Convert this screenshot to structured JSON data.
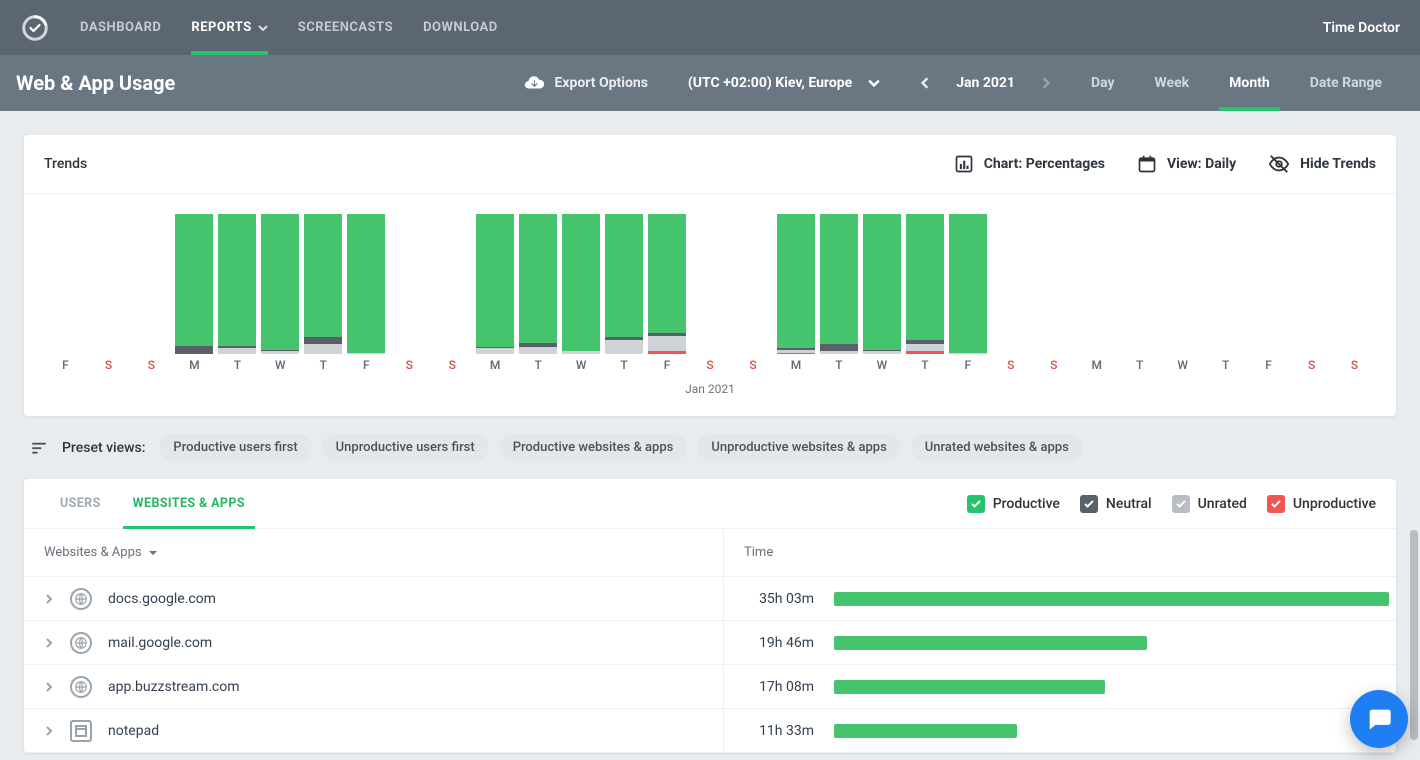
{
  "brand": "Time Doctor",
  "nav": {
    "dashboard": "DASHBOARD",
    "reports": "REPORTS",
    "screencasts": "SCREENCASTS",
    "download": "DOWNLOAD"
  },
  "page_title": "Web & App Usage",
  "subbar": {
    "export": "Export Options",
    "timezone": "(UTC +02:00) Kiev, Europe",
    "date_label": "Jan 2021",
    "periods": {
      "day": "Day",
      "week": "Week",
      "month": "Month",
      "range": "Date Range"
    },
    "selected_period": "month"
  },
  "trends": {
    "title": "Trends",
    "chart_label": "Chart: Percentages",
    "view_label": "View: Daily",
    "hide_label": "Hide Trends",
    "month_caption": "Jan 2021"
  },
  "presets": {
    "label": "Preset views:",
    "items": [
      "Productive users first",
      "Unproductive users first",
      "Productive websites & apps",
      "Unproductive websites & apps",
      "Unrated websites & apps"
    ]
  },
  "data_tabs": {
    "users": "USERS",
    "sites": "WEBSITES & APPS"
  },
  "legend": {
    "productive": "Productive",
    "neutral": "Neutral",
    "unrated": "Unrated",
    "unproductive": "Unproductive"
  },
  "table": {
    "col_left": "Websites & Apps",
    "col_right": "Time",
    "max_minutes": 2103,
    "rows": [
      {
        "name": "docs.google.com",
        "time": "35h 03m",
        "minutes": 2103,
        "icon": "globe"
      },
      {
        "name": "mail.google.com",
        "time": "19h 46m",
        "minutes": 1186,
        "icon": "globe"
      },
      {
        "name": "app.buzzstream.com",
        "time": "17h 08m",
        "minutes": 1028,
        "icon": "globe"
      },
      {
        "name": "notepad",
        "time": "11h 33m",
        "minutes": 693,
        "icon": "app"
      }
    ]
  },
  "chart_data": {
    "type": "bar",
    "title": "Trends",
    "xlabel": "Jan 2021",
    "ylabel": "Percent",
    "ylim": [
      0,
      100
    ],
    "days": [
      {
        "label": "F",
        "weekend": false,
        "productive": null,
        "neutral": null,
        "unrated": null,
        "unproductive": null
      },
      {
        "label": "S",
        "weekend": true,
        "productive": null,
        "neutral": null,
        "unrated": null,
        "unproductive": null
      },
      {
        "label": "S",
        "weekend": true,
        "productive": null,
        "neutral": null,
        "unrated": null,
        "unproductive": null
      },
      {
        "label": "M",
        "weekend": false,
        "productive": 94,
        "neutral": 6,
        "unrated": 0,
        "unproductive": 0
      },
      {
        "label": "T",
        "weekend": false,
        "productive": 94,
        "neutral": 2,
        "unrated": 4,
        "unproductive": 0
      },
      {
        "label": "W",
        "weekend": false,
        "productive": 97,
        "neutral": 1,
        "unrated": 2,
        "unproductive": 0
      },
      {
        "label": "T",
        "weekend": false,
        "productive": 88,
        "neutral": 5,
        "unrated": 7,
        "unproductive": 0
      },
      {
        "label": "F",
        "weekend": false,
        "productive": 99,
        "neutral": 0,
        "unrated": 1,
        "unproductive": 0
      },
      {
        "label": "S",
        "weekend": true,
        "productive": null,
        "neutral": null,
        "unrated": null,
        "unproductive": null
      },
      {
        "label": "S",
        "weekend": true,
        "productive": null,
        "neutral": null,
        "unrated": null,
        "unproductive": null
      },
      {
        "label": "M",
        "weekend": false,
        "productive": 95,
        "neutral": 1,
        "unrated": 4,
        "unproductive": 0
      },
      {
        "label": "T",
        "weekend": false,
        "productive": 92,
        "neutral": 3,
        "unrated": 5,
        "unproductive": 0
      },
      {
        "label": "W",
        "weekend": false,
        "productive": 98,
        "neutral": 0,
        "unrated": 2,
        "unproductive": 0
      },
      {
        "label": "T",
        "weekend": false,
        "productive": 88,
        "neutral": 2,
        "unrated": 10,
        "unproductive": 0
      },
      {
        "label": "F",
        "weekend": false,
        "productive": 85,
        "neutral": 2,
        "unrated": 11,
        "unproductive": 2
      },
      {
        "label": "S",
        "weekend": true,
        "productive": null,
        "neutral": null,
        "unrated": null,
        "unproductive": null
      },
      {
        "label": "S",
        "weekend": true,
        "productive": null,
        "neutral": null,
        "unrated": null,
        "unproductive": null
      },
      {
        "label": "M",
        "weekend": false,
        "productive": 96,
        "neutral": 1,
        "unrated": 2,
        "unproductive": 1
      },
      {
        "label": "T",
        "weekend": false,
        "productive": 93,
        "neutral": 5,
        "unrated": 2,
        "unproductive": 0
      },
      {
        "label": "W",
        "weekend": false,
        "productive": 97,
        "neutral": 1,
        "unrated": 2,
        "unproductive": 0
      },
      {
        "label": "T",
        "weekend": false,
        "productive": 90,
        "neutral": 3,
        "unrated": 5,
        "unproductive": 2
      },
      {
        "label": "F",
        "weekend": false,
        "productive": 99,
        "neutral": 0,
        "unrated": 1,
        "unproductive": 0
      },
      {
        "label": "S",
        "weekend": true,
        "productive": null,
        "neutral": null,
        "unrated": null,
        "unproductive": null
      },
      {
        "label": "S",
        "weekend": true,
        "productive": null,
        "neutral": null,
        "unrated": null,
        "unproductive": null
      },
      {
        "label": "M",
        "weekend": false,
        "productive": null,
        "neutral": null,
        "unrated": null,
        "unproductive": null
      },
      {
        "label": "T",
        "weekend": false,
        "productive": null,
        "neutral": null,
        "unrated": null,
        "unproductive": null
      },
      {
        "label": "W",
        "weekend": false,
        "productive": null,
        "neutral": null,
        "unrated": null,
        "unproductive": null
      },
      {
        "label": "T",
        "weekend": false,
        "productive": null,
        "neutral": null,
        "unrated": null,
        "unproductive": null
      },
      {
        "label": "F",
        "weekend": false,
        "productive": null,
        "neutral": null,
        "unrated": null,
        "unproductive": null
      },
      {
        "label": "S",
        "weekend": true,
        "productive": null,
        "neutral": null,
        "unrated": null,
        "unproductive": null
      },
      {
        "label": "S",
        "weekend": true,
        "productive": null,
        "neutral": null,
        "unrated": null,
        "unproductive": null
      }
    ]
  }
}
